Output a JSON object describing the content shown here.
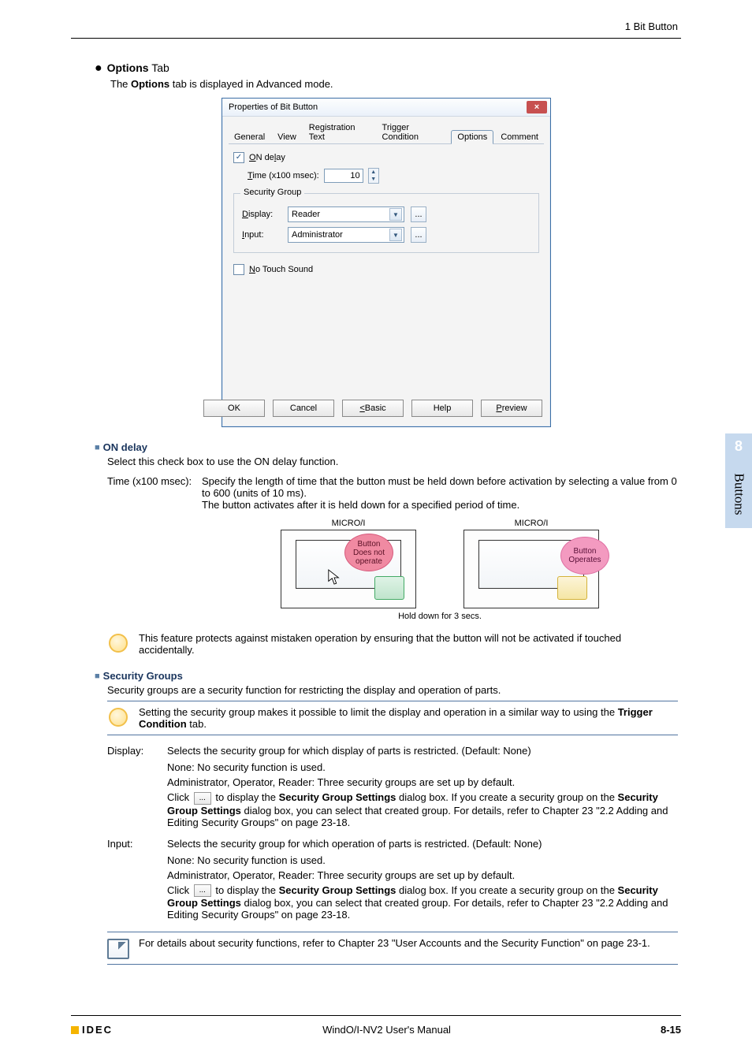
{
  "header": {
    "title": "1 Bit Button"
  },
  "side_tab": {
    "num": "8",
    "label": "Buttons"
  },
  "options": {
    "bullet_title_bold": "Options",
    "bullet_title_rest": " Tab",
    "intro_pre": "The ",
    "intro_bold": "Options",
    "intro_post": " tab is displayed in Advanced mode."
  },
  "dialog": {
    "title": "Properties of Bit Button",
    "close": "×",
    "tabs": {
      "general": "General",
      "view": "View",
      "reg": "Registration Text",
      "trig": "Trigger Condition",
      "options": "Options",
      "comment": "Comment"
    },
    "on_delay": {
      "check_label": "ON delay",
      "time_label": "Time (x100 msec):",
      "time_value": "10"
    },
    "security": {
      "legend": "Security Group",
      "display_label": "Display:",
      "display_value": "Reader",
      "input_label": "Input:",
      "input_value": "Administrator",
      "browse": "..."
    },
    "no_touch": "No Touch Sound",
    "buttons": {
      "ok": "OK",
      "cancel": "Cancel",
      "basic": "< Basic",
      "help": "Help",
      "preview": "Preview"
    }
  },
  "on_delay": {
    "heading": "ON delay",
    "intro": "Select this check box to use the ON delay function.",
    "time_key": "Time (x100 msec):",
    "time_line1": "Specify the length of time that the button must be held down before activation by selecting a value from 0 to 600 (units of 10 ms).",
    "time_line2": "The button activates after it is held down for a specified period of time.",
    "panel_label": "MICRO/I",
    "bubble_left_l1": "Button",
    "bubble_left_l2": "Does not",
    "bubble_left_l3": "operate",
    "bubble_right_l1": "Button",
    "bubble_right_l2": "Operates",
    "hold_label": "Hold down for 3 secs.",
    "tip": "This feature protects against mistaken operation by ensuring that the button will not be activated if touched accidentally."
  },
  "security_groups": {
    "heading": "Security Groups",
    "intro": "Security groups are a security function for restricting the display and operation of parts.",
    "tip_pre": "Setting the security group makes it possible to limit the display and operation in a similar way to using the ",
    "tip_bold": "Trigger Condition",
    "tip_post": " tab.",
    "display_key": "Display:",
    "display_line": "Selects the security group for which display of parts is restricted. (Default: None)",
    "none_line": "None: No security function is used.",
    "admin_line": "Administrator, Operator, Reader: Three security groups are set up by default.",
    "click_pre": "Click ",
    "click_mid1": " to display the ",
    "sgs_bold": "Security Group Settings",
    "click_mid2": " dialog box. If you create a security group on the ",
    "click_post": " dialog box, you can select that created group. For details, refer to Chapter 23 \"2.2 Adding and Editing Security Groups\" on page 23-18.",
    "input_key": "Input:",
    "input_line": "Selects the security group for which operation of parts is restricted. (Default: None)",
    "note": "For details about security functions, refer to Chapter 23 \"User Accounts and the Security Function\" on page 23-1."
  },
  "footer": {
    "brand": "IDEC",
    "manual": "WindO/I-NV2 User's Manual",
    "page": "8-15"
  }
}
